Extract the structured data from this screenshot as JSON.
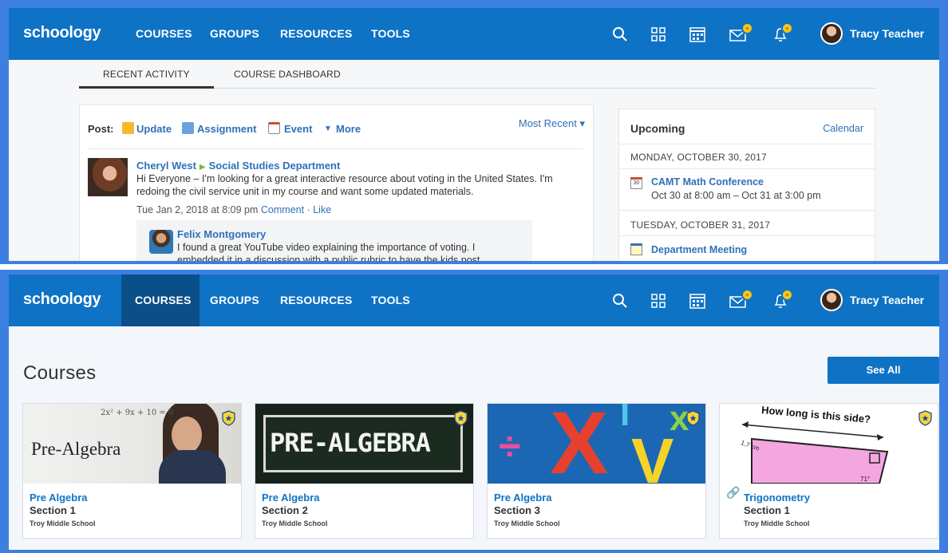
{
  "nav": {
    "logo": "schoology",
    "items": [
      "COURSES",
      "GROUPS",
      "RESOURCES",
      "TOOLS"
    ],
    "user": "Tracy Teacher",
    "icons": [
      "search-icon",
      "grid-apps-icon",
      "calendar-icon",
      "mail-icon",
      "bell-icon"
    ]
  },
  "tabs": [
    "RECENT ACTIVITY",
    "COURSE DASHBOARD"
  ],
  "feed": {
    "post_label": "Post:",
    "post_types": [
      "Update",
      "Assignment",
      "Event",
      "More"
    ],
    "sort": "Most Recent ▾",
    "post": {
      "author": "Cheryl West",
      "target": "Social Studies Department",
      "body": "Hi Everyone – I'm looking for a great interactive resource about voting in the United States.  I'm redoing the civil service unit in my course and want some updated materials.",
      "timestamp": "Tue Jan 2, 2018 at 8:09 pm",
      "comment": "Comment",
      "separator": "·",
      "like": "Like"
    },
    "reply": {
      "author": "Felix Montgomery",
      "body": "I found a great YouTube video explaining the importance of voting. I embedded it in a discussion with a public rubric to have the kids post"
    }
  },
  "upcoming": {
    "title": "Upcoming",
    "calendar_link": "Calendar",
    "days": [
      {
        "date": "MONDAY, OCTOBER 30, 2017",
        "icon_text": "30",
        "event": "CAMT Math Conference",
        "time": "Oct 30 at 8:00 am – Oct 31 at 3:00 pm"
      },
      {
        "date": "TUESDAY, OCTOBER 31, 2017",
        "event": "Department Meeting"
      }
    ]
  },
  "courses": {
    "title": "Courses",
    "see_all": "See All",
    "cards": [
      {
        "name": "Pre Algebra",
        "section": "Section 1",
        "school": "Troy Middle School",
        "image_text": "Pre-Algebra",
        "image_formula": "2x² + 9x + 10 = 0"
      },
      {
        "name": "Pre Algebra",
        "section": "Section 2",
        "school": "Troy Middle School",
        "image_text": "PRE-ALGEBRA"
      },
      {
        "name": "Pre Algebra",
        "section": "Section 3",
        "school": "Troy Middle School",
        "image_symbols": [
          "÷",
          "X",
          "I",
          "V",
          "x"
        ]
      },
      {
        "name": "Trigonometry",
        "section": "Section 1",
        "school": "Troy Middle School",
        "image_text": "How long is this side?",
        "image_labels": [
          "1,7 cm",
          "71°"
        ]
      }
    ]
  },
  "colors": {
    "brand": "#0e73c5",
    "brand_dark": "#0a4f87",
    "link": "#2f71b8",
    "badge": "#f5c518",
    "frame": "#3d7fe0"
  }
}
